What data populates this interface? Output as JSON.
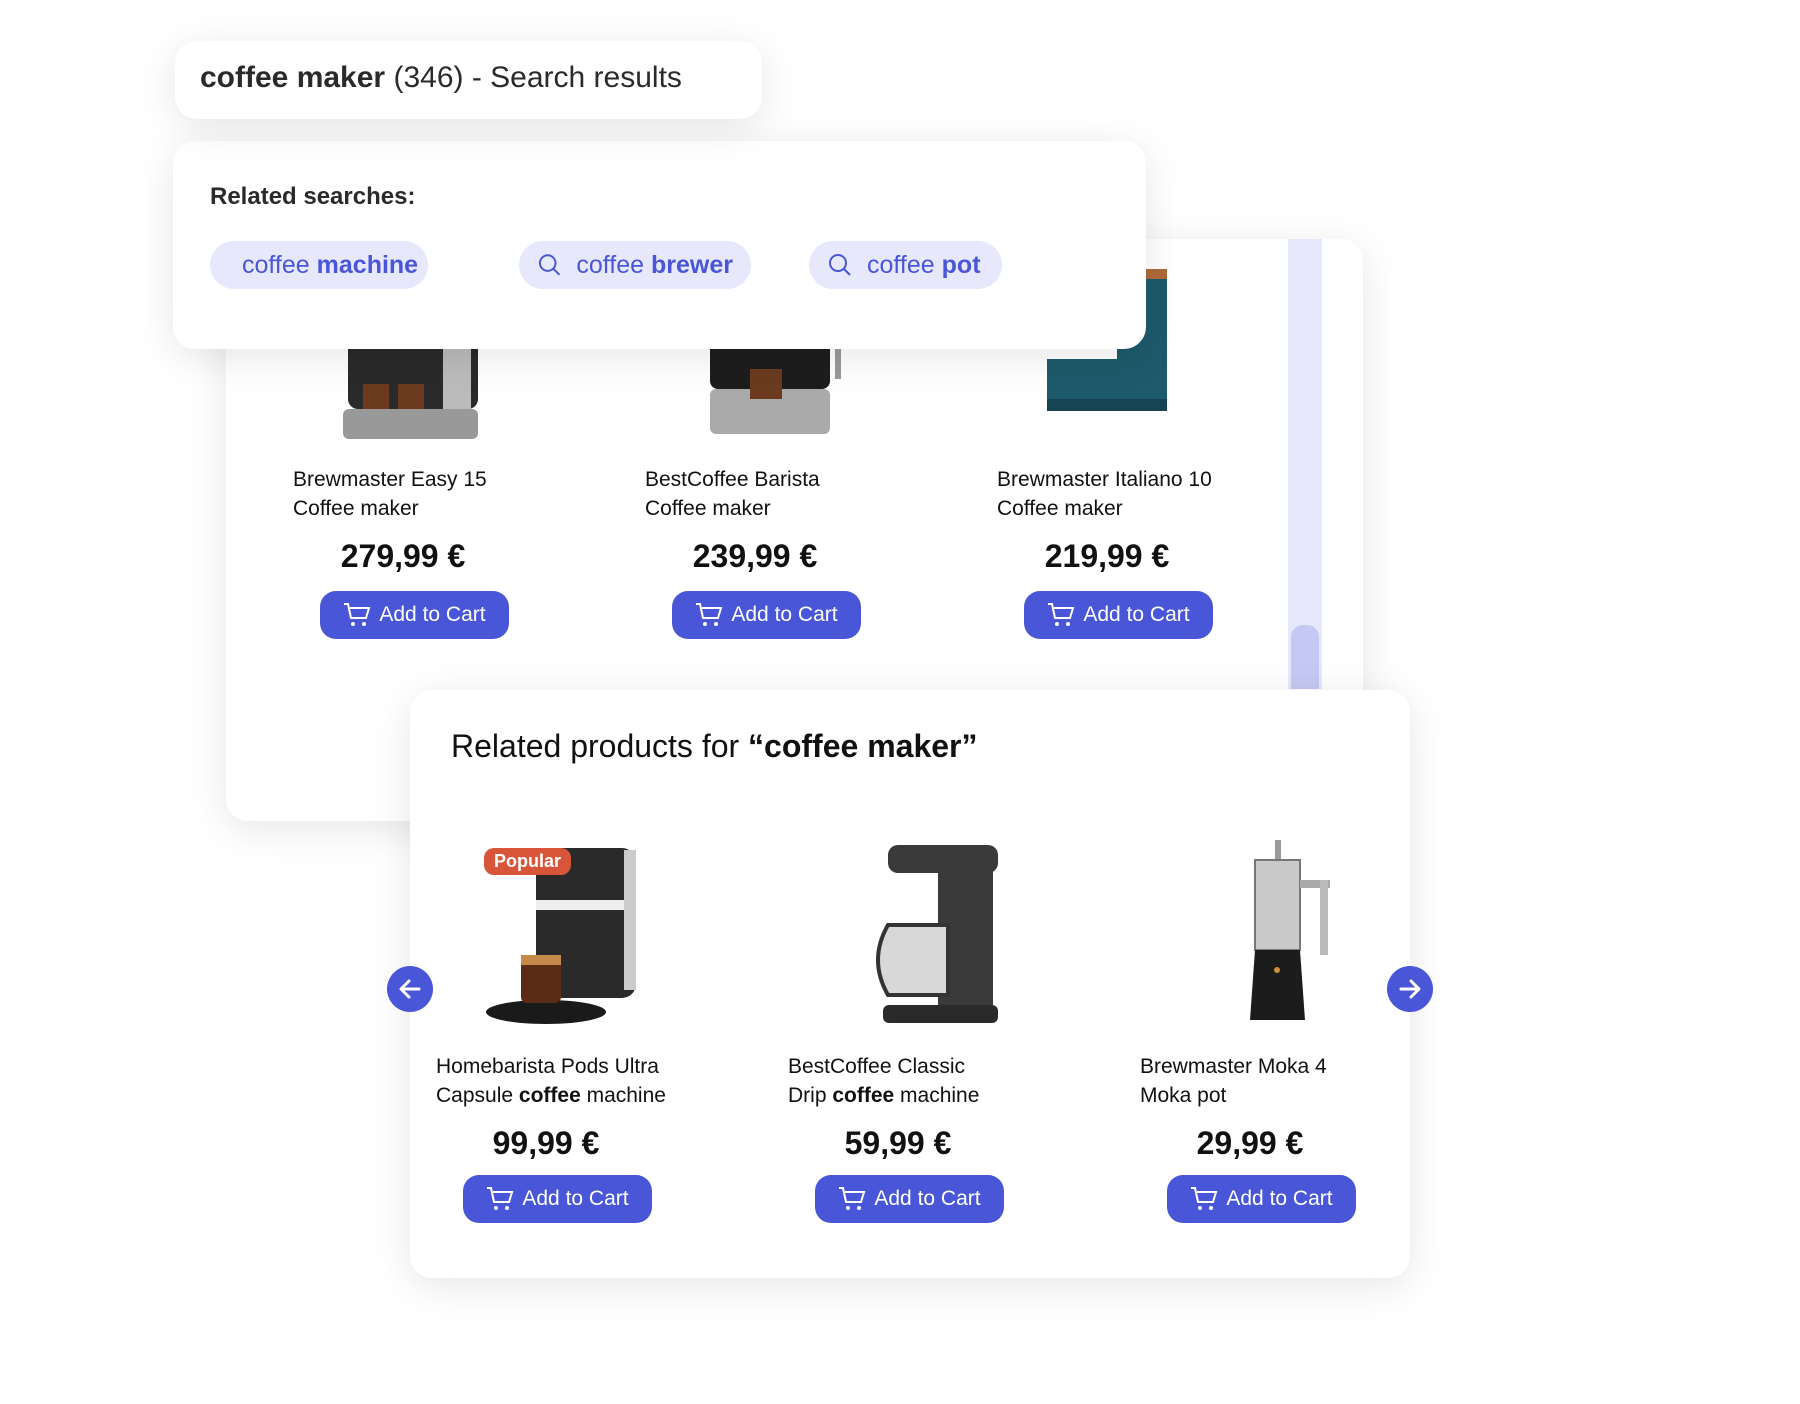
{
  "header": {
    "query": "coffee maker",
    "count": "(346)",
    "suffix": "- Search results"
  },
  "related_searches": {
    "heading": "Related searches:",
    "items": [
      {
        "prefix": "coffee",
        "bold": "machine",
        "icon": "search-icon"
      },
      {
        "prefix": "coffee",
        "bold": "brewer",
        "icon": "search-icon"
      },
      {
        "prefix": "coffee",
        "bold": "pot",
        "icon": "search-icon"
      }
    ]
  },
  "results": [
    {
      "line1": "Brewmaster Easy 15",
      "line2_pre": "Coffee maker",
      "line2_bold": "",
      "line2_post": "",
      "price": "279,99 €",
      "button": "Add to Cart"
    },
    {
      "line1": "BestCoffee Barista",
      "line2_pre": "Coffee maker",
      "line2_bold": "",
      "line2_post": "",
      "price": "239,99 €",
      "button": "Add to Cart"
    },
    {
      "line1": "Brewmaster Italiano 10",
      "line2_pre": "Coffee maker",
      "line2_bold": "",
      "line2_post": "",
      "price": "219,99 €",
      "button": "Add to Cart"
    }
  ],
  "related_products": {
    "heading_pre": "Related products for ",
    "heading_bold": "“coffee maker”",
    "items": [
      {
        "badge": "Popular",
        "line1": "Homebarista Pods Ultra",
        "line2_pre": "Capsule ",
        "line2_bold": "coffee",
        "line2_post": " machine",
        "price": "99,99 €",
        "button": "Add to Cart"
      },
      {
        "line1": "BestCoffee Classic",
        "line2_pre": "Drip ",
        "line2_bold": "coffee",
        "line2_post": " machine",
        "price": "59,99 €",
        "button": "Add to Cart"
      },
      {
        "line1": "Brewmaster Moka 4",
        "line2_pre": "Moka pot",
        "line2_bold": "",
        "line2_post": "",
        "price": "29,99 €",
        "button": "Add to Cart"
      }
    ]
  },
  "colors": {
    "accent": "#4a56d8",
    "chip_bg": "#e7e8fb",
    "badge": "#d9553a"
  }
}
